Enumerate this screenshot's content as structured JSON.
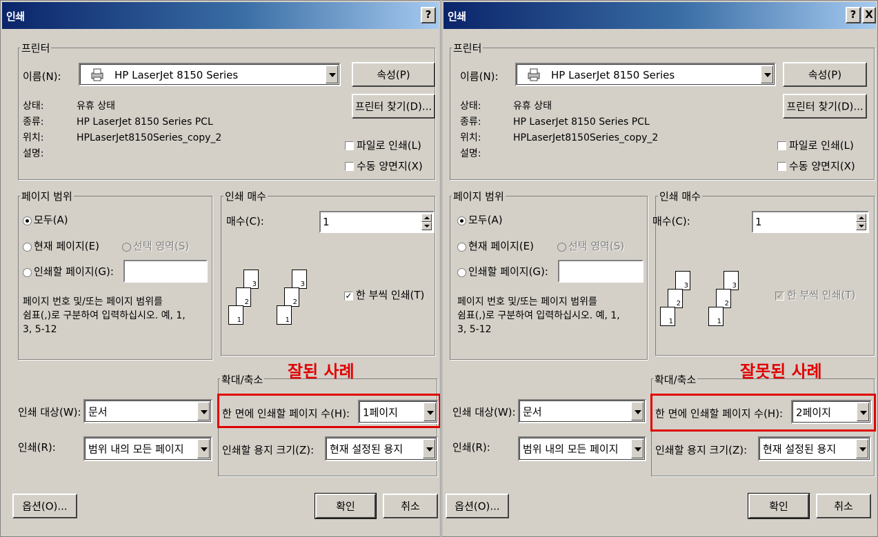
{
  "dialogs": [
    {
      "title": "인쇄",
      "help_btn": "?",
      "close_btn": "",
      "printer": {
        "legend": "프린터",
        "name_label": "이름(N):",
        "name_value": "HP LaserJet 8150 Series",
        "properties_btn": "속성(P)",
        "find_btn": "프린터 찾기(D)...",
        "status_label": "상태:",
        "status_value": "유휴 상태",
        "type_label": "종류:",
        "type_value": "HP LaserJet 8150 Series PCL",
        "where_label": "위치:",
        "where_value": "HPLaserJet8150Series_copy_2",
        "comment_label": "설명:",
        "print_to_file": "파일로 인쇄(L)",
        "manual_duplex": "수동 양면지(X)"
      },
      "range": {
        "legend": "페이지 범위",
        "all": "모두(A)",
        "current": "현재 페이지(E)",
        "selection": "선택 영역(S)",
        "pages": "인쇄할 페이지(G):",
        "hint1": "페이지 번호 및/또는 페이지 범위를",
        "hint2": "쉼표(,)로 구분하여 입력하십시오. 예, 1,",
        "hint3": "3, 5-12"
      },
      "copies": {
        "legend": "인쇄 매수",
        "count_label": "매수(C):",
        "count_value": "1",
        "collate": "한 부씩 인쇄(T)",
        "collate_checked": true,
        "collate_enabled": true
      },
      "zoom": {
        "legend": "확대/축소",
        "pages_per_sheet_label": "한 면에 인쇄할 페이지 수(H):",
        "pages_per_sheet_value": "1페이지",
        "scale_label": "인쇄할 용지 크기(Z):",
        "scale_value": "현재 설정된 용지"
      },
      "print_what_label": "인쇄 대상(W):",
      "print_what_value": "문서",
      "print_label": "인쇄(R):",
      "print_value": "범위 내의 모든 페이지",
      "options_btn": "옵션(O)...",
      "ok_btn": "확인",
      "cancel_btn": "취소",
      "annotation": "잘된  사례",
      "page_nums": [
        "3",
        "2",
        "1"
      ]
    },
    {
      "title": "인쇄",
      "help_btn": "?",
      "close_btn": "X",
      "printer": {
        "legend": "프린터",
        "name_label": "이름(N):",
        "name_value": "HP LaserJet 8150 Series",
        "properties_btn": "속성(P)",
        "find_btn": "프린터 찾기(D)...",
        "status_label": "상태:",
        "status_value": "유휴 상태",
        "type_label": "종류:",
        "type_value": "HP LaserJet 8150 Series PCL",
        "where_label": "위치:",
        "where_value": "HPLaserJet8150Series_copy_2",
        "comment_label": "설명:",
        "print_to_file": "파일로 인쇄(L)",
        "manual_duplex": "수동 양면지(X)"
      },
      "range": {
        "legend": "페이지 범위",
        "all": "모두(A)",
        "current": "현재 페이지(E)",
        "selection": "선택 영역(S)",
        "pages": "인쇄할 페이지(G):",
        "hint1": "페이지 번호 및/또는 페이지 범위를",
        "hint2": "쉼표(,)로 구분하여 입력하십시오. 예, 1,",
        "hint3": "3, 5-12"
      },
      "copies": {
        "legend": "인쇄 매수",
        "count_label": "매수(C):",
        "count_value": "1",
        "collate": "한 부씩 인쇄(T)",
        "collate_checked": true,
        "collate_enabled": false
      },
      "zoom": {
        "legend": "확대/축소",
        "pages_per_sheet_label": "한 면에 인쇄할 페이지 수(H):",
        "pages_per_sheet_value": "2페이지",
        "scale_label": "인쇄할 용지 크기(Z):",
        "scale_value": "현재 설정된 용지"
      },
      "print_what_label": "인쇄 대상(W):",
      "print_what_value": "문서",
      "print_label": "인쇄(R):",
      "print_value": "범위 내의 모든 페이지",
      "options_btn": "옵션(O)...",
      "ok_btn": "확인",
      "cancel_btn": "취소",
      "annotation": "잘못된  사례",
      "page_nums": [
        "3",
        "2",
        "1"
      ]
    }
  ],
  "colors": {
    "dialog_bg": "#d4d0c8",
    "title_start": "#0a246a",
    "title_end": "#a6caf0",
    "highlight_red": "#e00000"
  }
}
